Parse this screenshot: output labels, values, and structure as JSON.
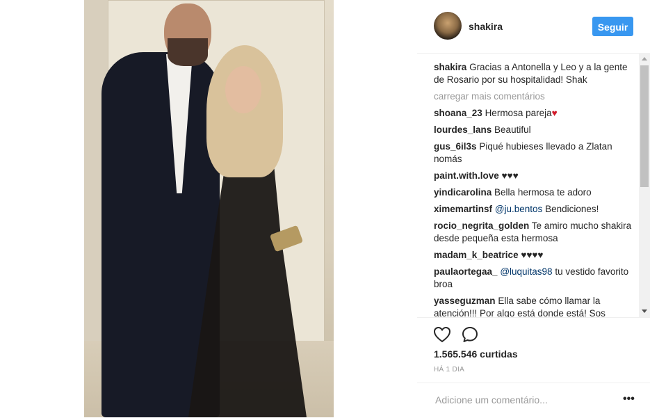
{
  "post": {
    "username": "shakira",
    "follow_label": "Seguir",
    "caption": {
      "user": "shakira",
      "text": "Gracias a Antonella y Leo y a la gente de Rosario por su hospitalidad! Shak"
    },
    "load_more_label": "carregar mais comentários",
    "comments": [
      {
        "user": "shoana_23",
        "text": "Hermosa pareja",
        "suffix": "♥"
      },
      {
        "user": "lourdes_lans",
        "text": "Beautiful"
      },
      {
        "user": "gus_6il3s",
        "text": "Piqué hubieses llevado a Zlatan nomás"
      },
      {
        "user": "paint.with.love",
        "text": "♥♥♥"
      },
      {
        "user": "yindicarolina",
        "text": "Bella hermosa te adoro"
      },
      {
        "user": "ximemartinsf",
        "mention": "@ju.bentos",
        "text": "Bendiciones!"
      },
      {
        "user": "rocio_negrita_golden",
        "text": "Te amiro mucho shakira desde pequeña esta hermosa"
      },
      {
        "user": "madam_k_beatrice",
        "text": "♥♥♥♥"
      },
      {
        "user": "paulaortegaa_",
        "mention": "@luquitas98",
        "text": "tu vestido favorito broa"
      },
      {
        "user": "yasseguzman",
        "text": "Ella sabe cómo llamar la atención!!! Por algo está donde está! Sos"
      }
    ],
    "likes_text": "1.565.546 curtidas",
    "time_text": "HÁ 1 DIA",
    "add_comment_placeholder": "Adicione um comentário...",
    "more_options_label": "•••"
  },
  "icons": {
    "like": "heart-outline-icon",
    "comment": "speech-bubble-icon",
    "more": "ellipsis-icon"
  },
  "colors": {
    "accent": "#3897f0",
    "text": "#262626",
    "muted": "#999999",
    "heart": "#d11a2a",
    "mention": "#003569"
  }
}
